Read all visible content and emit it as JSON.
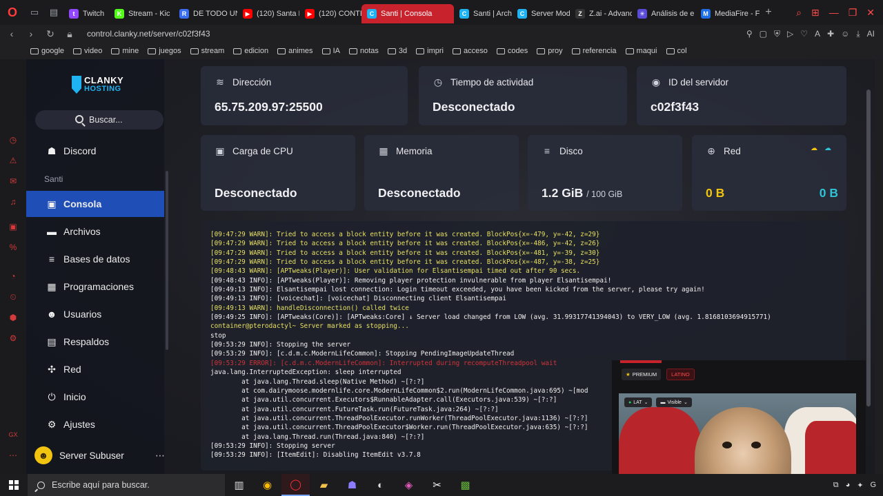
{
  "browser": {
    "tabs": [
      {
        "label": "Twitch",
        "favicon": "twitch-icon",
        "color": "#9146ff",
        "glyph": "t"
      },
      {
        "label": "Stream - Kic",
        "favicon": "kick-icon",
        "color": "#53fc18",
        "glyph": "K"
      },
      {
        "label": "DE TODO UN",
        "favicon": "r-icon",
        "color": "#3a6df0",
        "glyph": "R"
      },
      {
        "label": "(120) Santa F",
        "favicon": "youtube-icon",
        "color": "#ff0000",
        "glyph": "▶"
      },
      {
        "label": "(120) CONTE",
        "favicon": "youtube-icon",
        "color": "#ff0000",
        "glyph": "▶"
      },
      {
        "label": "Santi | Consola",
        "favicon": "clanky-icon",
        "color": "#1fb3f2",
        "glyph": "C",
        "active": true
      },
      {
        "label": "Santi | Archi",
        "favicon": "clanky-icon",
        "color": "#1fb3f2",
        "glyph": "C"
      },
      {
        "label": "Server Mods",
        "favicon": "clanky-icon",
        "color": "#1fb3f2",
        "glyph": "C"
      },
      {
        "label": "Z.ai - Advanc",
        "favicon": "zai-icon",
        "color": "#333333",
        "glyph": "Z"
      },
      {
        "label": "Análisis de e",
        "favicon": "claude-icon",
        "color": "#5a4bd6",
        "glyph": "✳"
      },
      {
        "label": "MediaFire - F",
        "favicon": "mediafire-icon",
        "color": "#1c6de6",
        "glyph": "M"
      }
    ],
    "url": "control.clanky.net/server/c02f3f43",
    "bookmarks": [
      "google",
      "video",
      "mine",
      "juegos",
      "stream",
      "edicion",
      "animes",
      "IA",
      "notas",
      "3d",
      "impri",
      "acceso",
      "codes",
      "proy",
      "referencia",
      "maqui",
      "col"
    ]
  },
  "sidebar": {
    "brand_top": "CLANKY",
    "brand_bottom": "HOSTING",
    "search_label": "Buscar...",
    "discord_label": "Discord",
    "section_label": "Santi",
    "items": [
      {
        "label": "Consola",
        "icon": "terminal-icon",
        "glyph": "▣",
        "active": true
      },
      {
        "label": "Archivos",
        "icon": "folder-icon",
        "glyph": "▬"
      },
      {
        "label": "Bases de datos",
        "icon": "database-icon",
        "glyph": "≡"
      },
      {
        "label": "Programaciones",
        "icon": "calendar-icon",
        "glyph": "▦"
      },
      {
        "label": "Usuarios",
        "icon": "users-icon",
        "glyph": "☻"
      },
      {
        "label": "Respaldos",
        "icon": "archive-icon",
        "glyph": "▤"
      },
      {
        "label": "Red",
        "icon": "network-icon",
        "glyph": "✣"
      },
      {
        "label": "Inicio",
        "icon": "power-icon",
        "glyph": "⏻"
      },
      {
        "label": "Ajustes",
        "icon": "gear-icon",
        "glyph": "⚙"
      }
    ],
    "user": {
      "name": "Server Subuser",
      "menu": "⋯"
    }
  },
  "cards": {
    "address": {
      "title": "Dirección",
      "value": "65.75.209.97:25500"
    },
    "uptime": {
      "title": "Tiempo de actividad",
      "value": "Desconectado"
    },
    "server_id": {
      "title": "ID del servidor",
      "value": "c02f3f43"
    },
    "cpu": {
      "title": "Carga de CPU",
      "value": "Desconectado"
    },
    "memory": {
      "title": "Memoria",
      "value": "Desconectado"
    },
    "disk": {
      "title": "Disco",
      "value": "1.2 GiB",
      "limit": "/ 100 GiB"
    },
    "network": {
      "title": "Red",
      "in": "0 B",
      "out": "0 B",
      "in_color": "#f1c40f",
      "out_color": "#2ec4d6"
    }
  },
  "console": {
    "lines": [
      {
        "t": "[09:47:29 WARN]: Tried to access a block entity before it was created. BlockPos{x=-479, y=-42, z=29}",
        "k": "warn"
      },
      {
        "t": "[09:47:29 WARN]: Tried to access a block entity before it was created. BlockPos{x=-486, y=-42, z=26}",
        "k": "warn"
      },
      {
        "t": "[09:47:29 WARN]: Tried to access a block entity before it was created. BlockPos{x=-481, y=-39, z=30}",
        "k": "warn"
      },
      {
        "t": "[09:47:29 WARN]: Tried to access a block entity before it was created. BlockPos{x=-487, y=-38, z=25}",
        "k": "warn"
      },
      {
        "t": "[09:48:43 WARN]: [APTweaks(Player)]: User validation for Elsantisempai timed out after 90 secs.",
        "k": "warn"
      },
      {
        "t": "[09:48:43 INFO]: [APTweaks(Player)]: Removing player protection invulnerable from player Elsantisempai!",
        "k": "info"
      },
      {
        "t": "[09:49:13 INFO]: Elsantisempai lost connection: Login timeout exceeded, you have been kicked from the server, please try again!",
        "k": "info"
      },
      {
        "t": "[09:49:13 INFO]: [voicechat]: [voicechat] Disconnecting client Elsantisempai",
        "k": "info"
      },
      {
        "t": "[09:49:13 WARN]: handleDisconnection() called twice",
        "k": "warn"
      },
      {
        "t": "[09:49:25 INFO]: [APTweaks(Core)]: [APTweaks:Core] ↓ Server load changed from LOW (avg. 31.99317741394043) to VERY_LOW (avg. 1.8168103694915771)",
        "k": "info"
      },
      {
        "t": "container@pterodactyl~ Server marked as stopping...",
        "k": "prompt"
      },
      {
        "t": "stop",
        "k": "info"
      },
      {
        "t": "[09:53:29 INFO]: Stopping the server",
        "k": "info"
      },
      {
        "t": "[09:53:29 INFO]: [c.d.m.c.ModernLifeCommon]: Stopping PendingImageUpdateThread",
        "k": "info"
      },
      {
        "t": "[09:53:29 ERROR]: [c.d.m.c.ModernLifeCommon]: Interrupted during recomputeThreadpool wait",
        "k": "err"
      },
      {
        "t": "java.lang.InterruptedException: sleep interrupted",
        "k": "info"
      },
      {
        "t": "        at java.lang.Thread.sleep(Native Method) ~[?:?]",
        "k": "info"
      },
      {
        "t": "        at com.dairymoose.modernlife.core.ModernLifeCommon$2.run(ModernLifeCommon.java:695) ~[mod",
        "k": "info"
      },
      {
        "t": "        at java.util.concurrent.Executors$RunnableAdapter.call(Executors.java:539) ~[?:?]",
        "k": "info"
      },
      {
        "t": "        at java.util.concurrent.FutureTask.run(FutureTask.java:264) ~[?:?]",
        "k": "info"
      },
      {
        "t": "        at java.util.concurrent.ThreadPoolExecutor.runWorker(ThreadPoolExecutor.java:1136) ~[?:?]",
        "k": "info"
      },
      {
        "t": "        at java.util.concurrent.ThreadPoolExecutor$Worker.run(ThreadPoolExecutor.java:635) ~[?:?]",
        "k": "info"
      },
      {
        "t": "        at java.lang.Thread.run(Thread.java:840) ~[?:?]",
        "k": "info"
      },
      {
        "t": "[09:53:29 INFO]: Stopping server",
        "k": "info"
      },
      {
        "t": "[09:53:29 INFO]: [ItemEdit]: Disabling ItemEdit v3.7.8",
        "k": "info"
      }
    ]
  },
  "video_overlay": {
    "premium_label": "PREMIUM",
    "live_label": "LATINO",
    "lang_label": "LAT",
    "visibility_label": "Visible"
  },
  "taskbar": {
    "search_placeholder": "Escribe aquí para buscar."
  }
}
